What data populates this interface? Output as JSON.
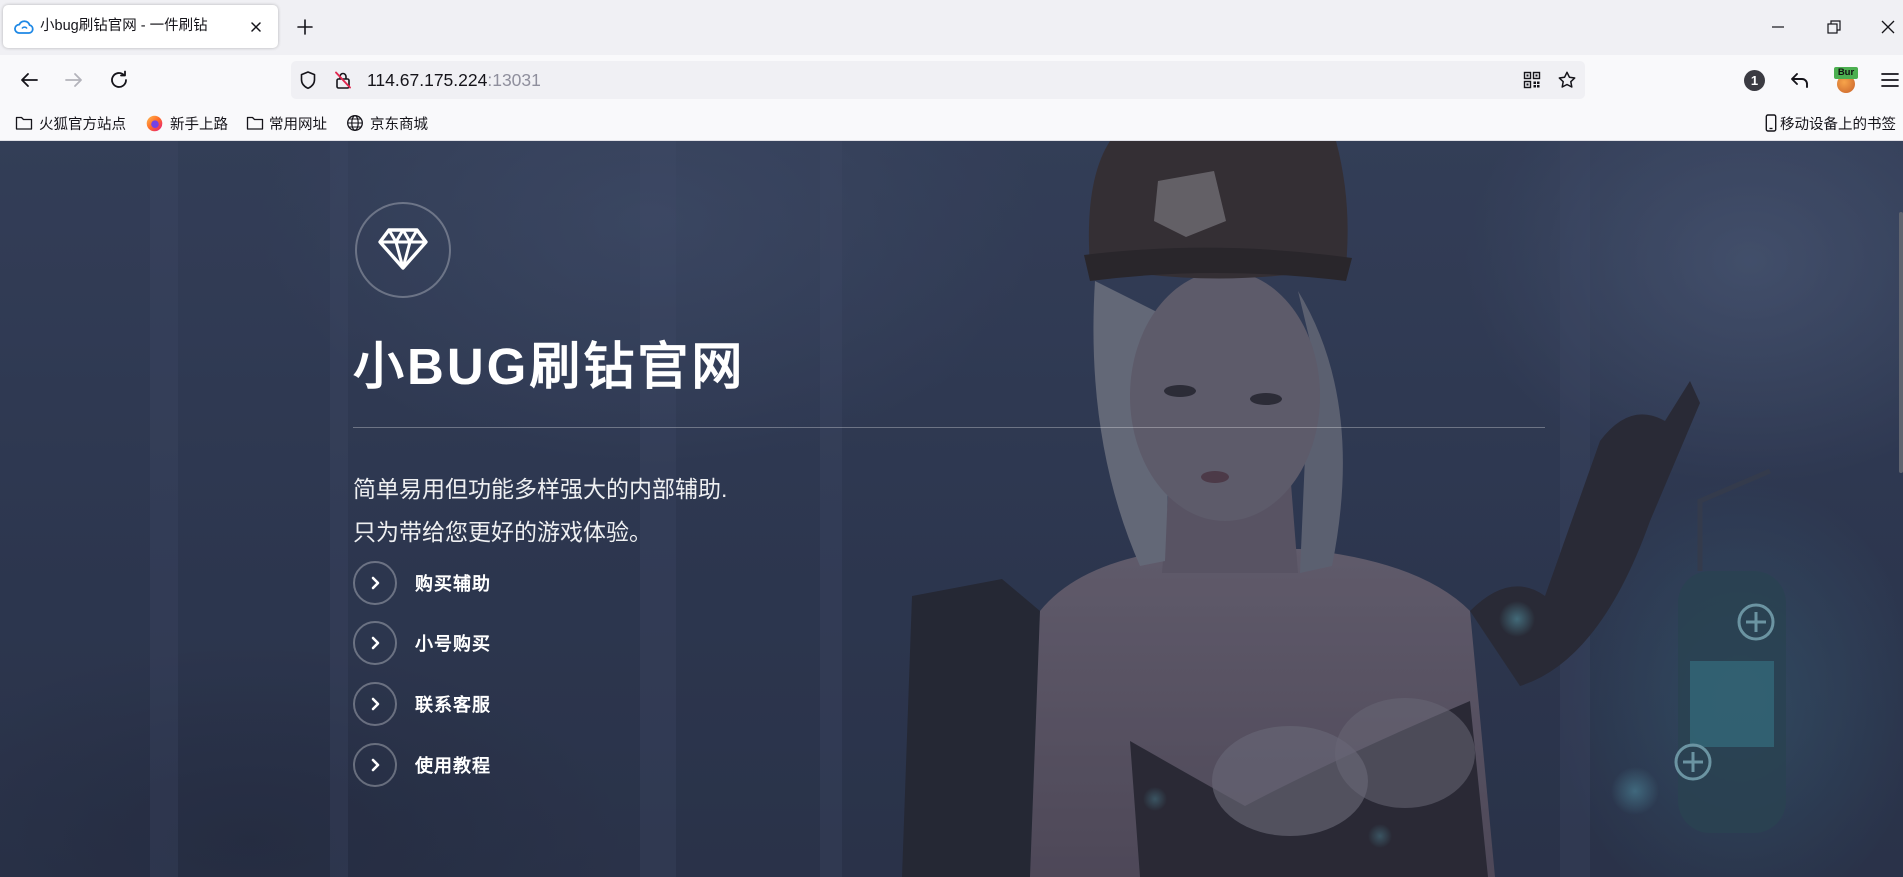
{
  "browser": {
    "tab": {
      "title": "小bug刷钻官网 - 一件刷钻",
      "favicon": "cloud-icon"
    },
    "address": {
      "host": "114.67.175.224",
      "port": ":13031"
    },
    "extensions": {
      "badge_count": "1",
      "burp_label": "Bur"
    },
    "bookmarks": [
      {
        "label": "火狐官方站点",
        "icon": "folder-icon"
      },
      {
        "label": "新手上路",
        "icon": "firefox-icon"
      },
      {
        "label": "常用网址",
        "icon": "folder-icon"
      },
      {
        "label": "京东商城",
        "icon": "globe-icon"
      }
    ],
    "mobile_bookmarks": {
      "label": "移动设备上的书签",
      "icon": "mobile-device-icon"
    }
  },
  "page": {
    "logo_icon": "diamond-icon",
    "title": "小BUG刷钻官网",
    "description": [
      "简单易用但功能多样强大的内部辅助.",
      "只为带给您更好的游戏体验。"
    ],
    "menu": [
      {
        "label": "购买辅助",
        "icon": "chevron-right-icon"
      },
      {
        "label": "小号购买",
        "icon": "chevron-right-icon"
      },
      {
        "label": "联系客服",
        "icon": "chevron-right-icon"
      },
      {
        "label": "使用教程",
        "icon": "chevron-right-icon"
      }
    ]
  },
  "colors": {
    "tab_bar": "#f0f0f4",
    "toolbar": "#f9f9fb",
    "url_port": "#8f8f9d",
    "insecure_slash": "#e22850",
    "page_background": "#313c56",
    "page_text": "#ffffff"
  }
}
